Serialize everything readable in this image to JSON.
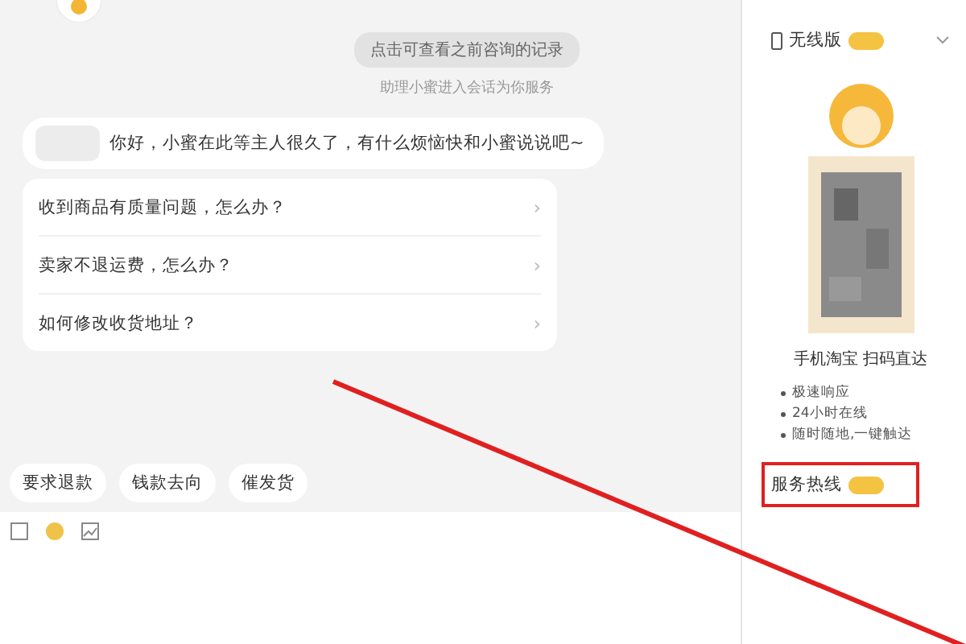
{
  "chat": {
    "history_link": "点击可查看之前咨询的记录",
    "system_note": "助理小蜜进入会话为你服务",
    "greeting": "你好，小蜜在此等主人很久了，有什么烦恼快和小蜜说说吧~",
    "questions": [
      {
        "text": "收到商品有质量问题，怎么办？",
        "arrow": "›"
      },
      {
        "text": "卖家不退运费，怎么办？",
        "arrow": "›"
      },
      {
        "text": "如何修改收货地址？",
        "arrow": "›"
      }
    ],
    "quick_replies": [
      "要求退款",
      "钱款去向",
      "催发货"
    ]
  },
  "sidebar": {
    "mobile": {
      "title": "无线版",
      "caption": "手机淘宝 扫码直达",
      "features": [
        "极速响应",
        "24小时在线",
        "随时随地,一键触达"
      ]
    },
    "hotline": {
      "title": "服务热线"
    }
  }
}
